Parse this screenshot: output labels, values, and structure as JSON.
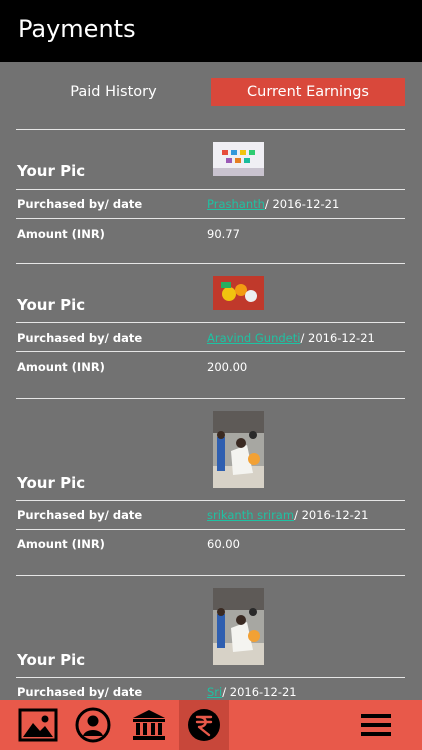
{
  "header": {
    "title": "Payments"
  },
  "tabs": {
    "paid_history": "Paid History",
    "current_earnings": "Current Earnings"
  },
  "labels": {
    "your_pic": "Your Pic",
    "purchased_by": "Purchased by/ date",
    "amount": "Amount (INR)"
  },
  "items": [
    {
      "buyer": "Prashanth",
      "date": "/ 2016-12-21",
      "amount": "90.77"
    },
    {
      "buyer": "Aravind Gundeti",
      "date": "/ 2016-12-21",
      "amount": "200.00"
    },
    {
      "buyer": "srikanth sriram",
      "date": "/ 2016-12-21",
      "amount": "60.00"
    },
    {
      "buyer": "Sri",
      "date": "/ 2016-12-21",
      "amount": ""
    }
  ],
  "footer": {
    "icons": [
      "gallery-icon",
      "profile-icon",
      "bank-icon",
      "rupee-icon",
      "menu-icon"
    ],
    "active": "rupee-icon"
  },
  "colors": {
    "header_bg": "#000000",
    "body_bg": "#727272",
    "accent": "#d9483b",
    "footer_bg": "#e8594a",
    "link": "#1fc2a3"
  }
}
